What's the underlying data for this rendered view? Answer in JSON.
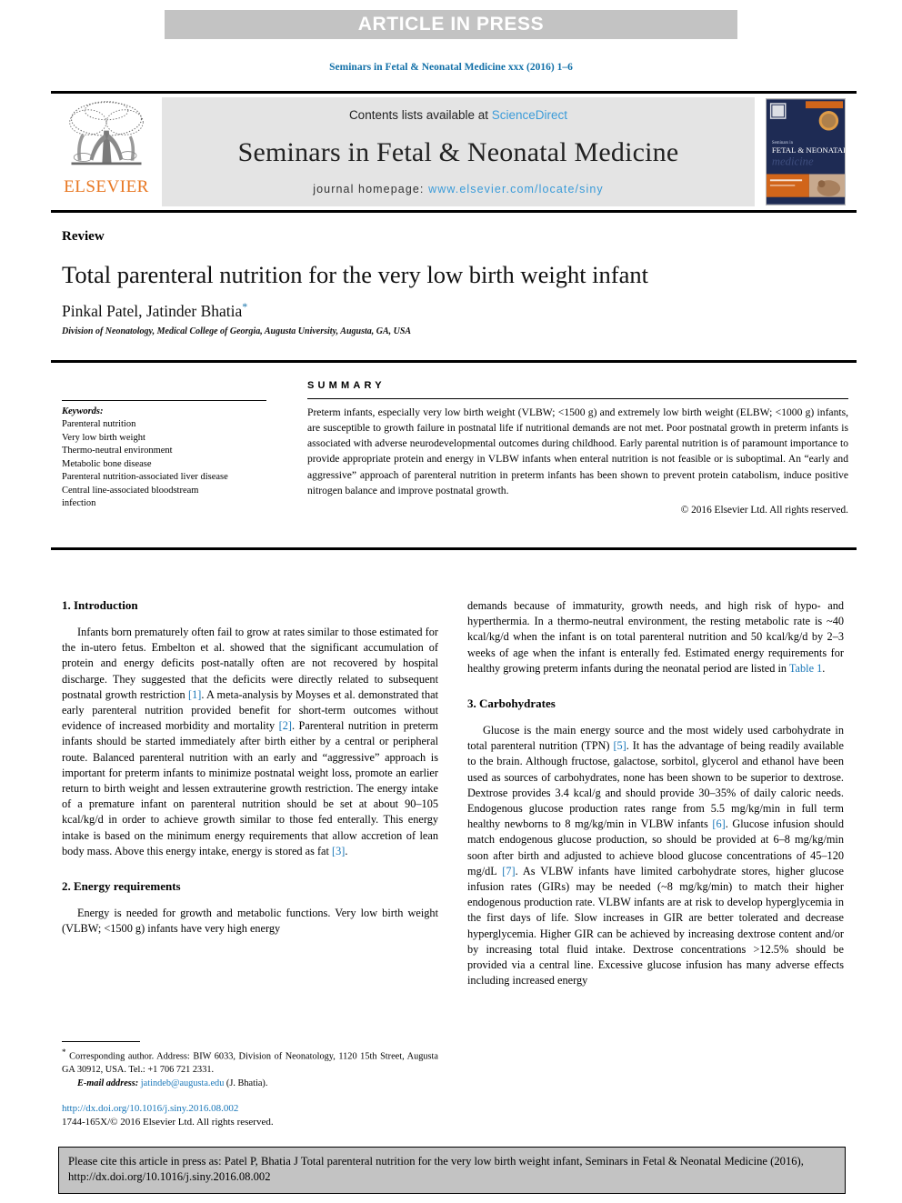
{
  "banner": {
    "label": "ARTICLE IN PRESS"
  },
  "running_head": "Seminars in Fetal & Neonatal Medicine xxx (2016) 1–6",
  "journal_header": {
    "contents_prefix": "Contents lists available at ",
    "sciencedirect": "ScienceDirect",
    "journal_title": "Seminars in Fetal & Neonatal Medicine",
    "homepage_prefix": "journal homepage: ",
    "homepage_url": "www.elsevier.com/locate/siny",
    "publisher": "ELSEVIER",
    "cover_title_line1": "Seminars in",
    "cover_title_line2": "FETAL & NEONATAL",
    "cover_title_line3": "medicine"
  },
  "article": {
    "doctype": "Review",
    "title": "Total parenteral nutrition for the very low birth weight infant",
    "authors": "Pinkal Patel, Jatinder Bhatia",
    "corresponding_marker": "*",
    "affiliation": "Division of Neonatology, Medical College of Georgia, Augusta University, Augusta, GA, USA"
  },
  "keywords": {
    "heading": "Keywords:",
    "items": [
      "Parenteral nutrition",
      "Very low birth weight",
      "Thermo-neutral environment",
      "Metabolic bone disease",
      "Parenteral nutrition-associated liver disease",
      "Central line-associated bloodstream",
      "infection"
    ]
  },
  "summary": {
    "heading": "SUMMARY",
    "body": "Preterm infants, especially very low birth weight (VLBW; <1500 g) and extremely low birth weight (ELBW; <1000 g) infants, are susceptible to growth failure in postnatal life if nutritional demands are not met. Poor postnatal growth in preterm infants is associated with adverse neurodevelopmental outcomes during childhood. Early parental nutrition is of paramount importance to provide appropriate protein and energy in VLBW infants when enteral nutrition is not feasible or is suboptimal. An “early and aggressive” approach of parenteral nutrition in preterm infants has been shown to prevent protein catabolism, induce positive nitrogen balance and improve postnatal growth.",
    "copyright": "© 2016 Elsevier Ltd. All rights reserved."
  },
  "sections": {
    "introduction": {
      "heading": "1. Introduction",
      "para1_a": "Infants born prematurely often fail to grow at rates similar to those estimated for the in-utero fetus. Embelton et al. showed that the significant accumulation of protein and energy deficits post-natally often are not recovered by hospital discharge. They suggested that the deficits were directly related to subsequent postnatal growth restriction ",
      "ref1": "[1]",
      "para1_b": ". A meta-analysis by Moyses et al. demonstrated that early parenteral nutrition provided benefit for short-term outcomes without evidence of increased morbidity and mortality ",
      "ref2": "[2]",
      "para1_c": ". Parenteral nutrition in preterm infants should be started immediately after birth either by a central or peripheral route. Balanced parenteral nutrition with an early and “aggressive” approach is important for preterm infants to minimize postnatal weight loss, promote an earlier return to birth weight and lessen extrauterine growth restriction. The energy intake of a premature infant on parenteral nutrition should be set at about 90–105 kcal/kg/d in order to achieve growth similar to those fed enterally. This energy intake is based on the minimum energy requirements that allow accretion of lean body mass. Above this energy intake, energy is stored as fat ",
      "ref3": "[3]",
      "para1_d": "."
    },
    "energy": {
      "heading": "2. Energy requirements",
      "para_left": "Energy is needed for growth and metabolic functions. Very low birth weight (VLBW; <1500 g) infants have very high energy",
      "para_right_a": "demands because of immaturity, growth needs, and high risk of hypo- and hyperthermia. In a thermo-neutral environment, the resting metabolic rate is ~40 kcal/kg/d when the infant is on total parenteral nutrition and 50 kcal/kg/d by 2–3 weeks of age when the infant is enterally fed. Estimated energy requirements for healthy growing preterm infants during the neonatal period are listed in ",
      "table_ref": "Table 1",
      "para_right_b": "."
    },
    "carbohydrates": {
      "heading": "3. Carbohydrates",
      "para_a": "Glucose is the main energy source and the most widely used carbohydrate in total parenteral nutrition (TPN) ",
      "ref5": "[5]",
      "para_b": ". It has the advantage of being readily available to the brain. Although fructose, galactose, sorbitol, glycerol and ethanol have been used as sources of carbohydrates, none has been shown to be superior to dextrose. Dextrose provides 3.4 kcal/g and should provide 30–35% of daily caloric needs. Endogenous glucose production rates range from 5.5 mg/kg/min in full term healthy newborns to 8 mg/kg/min in VLBW infants ",
      "ref6": "[6]",
      "para_c": ". Glucose infusion should match endogenous glucose production, so should be provided at 6–8 mg/kg/min soon after birth and adjusted to achieve blood glucose concentrations of 45–120 mg/dL ",
      "ref7": "[7]",
      "para_d": ". As VLBW infants have limited carbohydrate stores, higher glucose infusion rates (GIRs) may be needed (~8 mg/kg/min) to match their higher endogenous production rate. VLBW infants are at risk to develop hyperglycemia in the first days of life. Slow increases in GIR are better tolerated and decrease hyperglycemia. Higher GIR can be achieved by increasing dextrose content and/or by increasing total fluid intake. Dextrose concentrations >12.5% should be provided via a central line. Excessive glucose infusion has many adverse effects including increased energy"
    }
  },
  "footnote": {
    "marker": "*",
    "text": " Corresponding author. Address: BIW 6033, Division of Neonatology, 1120 15th Street, Augusta GA 30912, USA. Tel.: +1 706 721 2331.",
    "email_label": "E-mail address:",
    "email": "jatindeb@augusta.edu",
    "email_owner": "(J. Bhatia).",
    "doi": "http://dx.doi.org/10.1016/j.siny.2016.08.002",
    "issn": "1744-165X/© 2016 Elsevier Ltd. All rights reserved."
  },
  "citation_footer": {
    "text": "Please cite this article in press as: Patel P, Bhatia J Total parenteral nutrition for the very low birth weight infant, Seminars in Fetal & Neonatal Medicine (2016), http://dx.doi.org/10.1016/j.siny.2016.08.002"
  },
  "colors": {
    "link_blue": "#1876b8",
    "sciencedirect_blue": "#3a9bd9",
    "elsevier_orange": "#e87722",
    "banner_gray": "#c3c3c3",
    "header_gray": "#e4e4e4"
  }
}
